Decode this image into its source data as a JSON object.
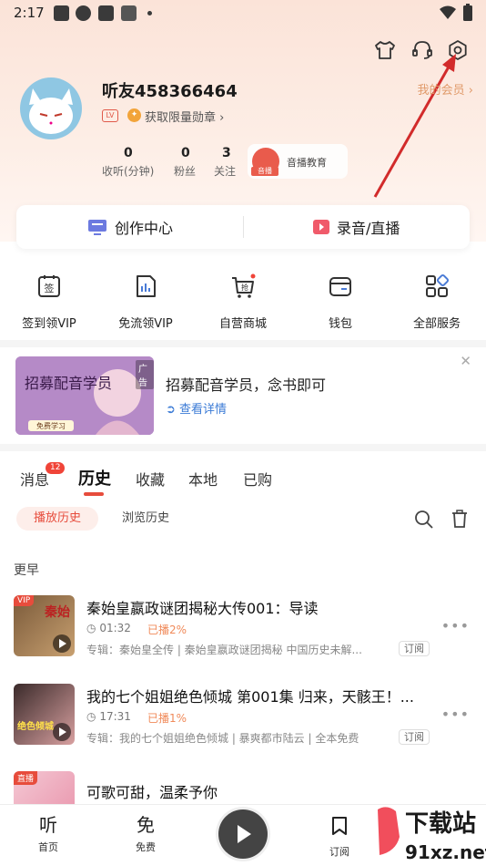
{
  "status_bar": {
    "time": "2:17"
  },
  "profile": {
    "username": "听友458366464",
    "level_badge": "LV",
    "medal_text": "获取限量勋章",
    "member_link": "我的会员",
    "stats": [
      {
        "value": "0",
        "label": "收听(分钟)"
      },
      {
        "value": "0",
        "label": "粉丝"
      },
      {
        "value": "3",
        "label": "关注"
      }
    ],
    "promo": {
      "tag": "音播",
      "label": "音播教育"
    }
  },
  "create_bar": {
    "left": "创作中心",
    "right": "录音/直播"
  },
  "services": [
    {
      "label": "签到领VIP",
      "icon": "checkin-icon",
      "glyph": "签"
    },
    {
      "label": "免流领VIP",
      "icon": "data-chart-icon",
      "glyph": ""
    },
    {
      "label": "自营商城",
      "icon": "shopping-cart-icon",
      "glyph": "抢"
    },
    {
      "label": "钱包",
      "icon": "wallet-icon",
      "glyph": ""
    },
    {
      "label": "全部服务",
      "icon": "grid-icon",
      "glyph": ""
    }
  ],
  "ad": {
    "tag": "广告",
    "title": "招募配音学员，念书即可",
    "link": "查看详情",
    "image_text": "招募配音学员",
    "image_sub": "免费学习"
  },
  "tabs": {
    "items": [
      "消息",
      "历史",
      "收藏",
      "本地",
      "已购"
    ],
    "active": "历史",
    "message_badge": "12"
  },
  "history_filters": {
    "active": "播放历史",
    "other": "浏览历史"
  },
  "section_label": "更早",
  "tracks": [
    {
      "title": "秦始皇嬴政谜团揭秘大传001：导读",
      "duration": "01:32",
      "progress": "已播2%",
      "album": "专辑：秦始皇全传 | 秦始皇嬴政谜团揭秘 中国历史未解...",
      "subscribe": "订阅",
      "cover_tag": "VIP",
      "cover_text": "秦始"
    },
    {
      "title": "我的七个姐姐绝色倾城 第001集 归来，天骸王！...",
      "duration": "17:31",
      "progress": "已播1%",
      "album": "专辑：我的七个姐姐绝色倾城 | 暴爽都市陆云 | 全本免费",
      "subscribe": "订阅",
      "cover_tag": "",
      "cover_text": "绝色倾城"
    },
    {
      "title": "可歌可甜，温柔予你",
      "duration": "",
      "progress": "",
      "album": "",
      "subscribe": "",
      "cover_tag": "直播",
      "cover_text": ""
    }
  ],
  "bottom_nav": [
    {
      "glyph": "听",
      "label": "首页"
    },
    {
      "glyph": "免",
      "label": "免费"
    },
    {
      "glyph": "",
      "label": "订阅"
    }
  ],
  "watermark": {
    "text1": "下载站",
    "text2": "91xz.net"
  },
  "colors": {
    "accent": "#e74c3c",
    "link": "#3b7bd6",
    "hero_bg": "#fbe3d8",
    "annotation_arrow": "#d22b2b"
  }
}
